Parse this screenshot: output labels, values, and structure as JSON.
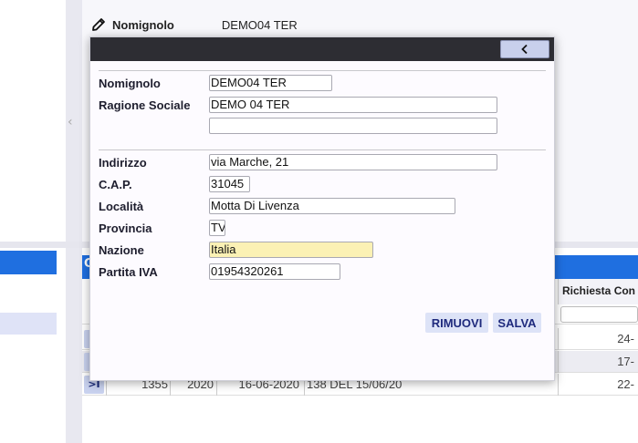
{
  "header": {
    "label": "Nomignolo",
    "value": "DEMO04 TER"
  },
  "grid": {
    "column_header": "Richiesta Con",
    "tab_letter": "C",
    "rows": [
      {
        "selector": "",
        "c1": "",
        "c2": "",
        "c3": "",
        "c4": "",
        "c5": "24-"
      },
      {
        "selector": "",
        "c1": "",
        "c2": "",
        "c3": "",
        "c4": "",
        "c5": "17-"
      },
      {
        "selector": ">I",
        "c1": "1355",
        "c2": "2020",
        "c3": "16-06-2020",
        "c4": "138 DEL 15/06/20",
        "c5": "22-"
      }
    ]
  },
  "dialog": {
    "fields": {
      "nomignolo": {
        "label": "Nomignolo",
        "value": "DEMO04 TER"
      },
      "ragione_sociale": {
        "label": "Ragione Sociale",
        "value": "DEMO 04 TER"
      },
      "ragione_sociale_2": {
        "value": ""
      },
      "indirizzo": {
        "label": "Indirizzo",
        "value": "via Marche, 21"
      },
      "cap": {
        "label": "C.A.P.",
        "value": "31045"
      },
      "localita": {
        "label": "Località",
        "value": "Motta Di Livenza"
      },
      "provincia": {
        "label": "Provincia",
        "value": "TV"
      },
      "nazione": {
        "label": "Nazione",
        "value": "Italia"
      },
      "partita_iva": {
        "label": "Partita IVA",
        "value": "01954320261"
      }
    },
    "buttons": {
      "remove": "RIMUOVI",
      "save": "SALVA"
    },
    "colors": {
      "titlebar": "#2d2d33",
      "button_bg": "#dde3f7",
      "button_text": "#1f2a7d",
      "highlight_field": "#fbf1b4"
    }
  },
  "icons": {
    "edit": "pencil-icon",
    "back": "chevron-left-icon",
    "collapse": "chevron-left-icon"
  }
}
